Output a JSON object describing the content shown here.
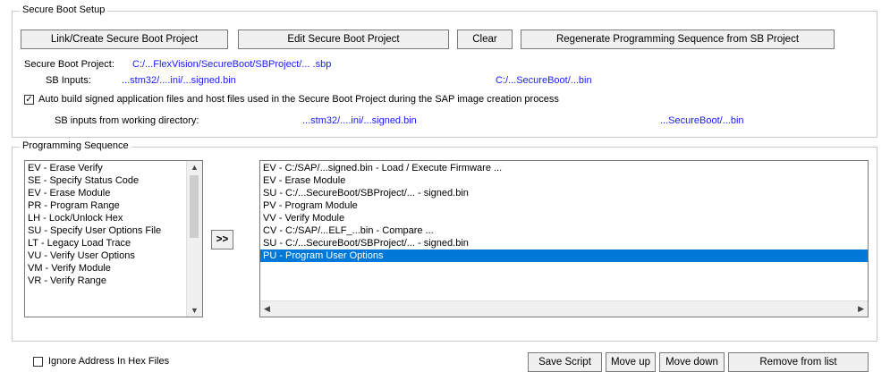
{
  "secure_boot": {
    "legend": "Secure Boot Setup",
    "buttons": {
      "link_create": "Link/Create Secure Boot Project",
      "edit": "Edit Secure Boot Project",
      "clear": "Clear",
      "regenerate": "Regenerate Programming Sequence from SB Project"
    },
    "project_label": "Secure Boot Project:",
    "project_path": "C:/...FlexVision/SecureBoot/SBProject/... .sbp",
    "sb_inputs_label": "SB Inputs:",
    "sb_inputs_path": "...stm32/....ini/...signed.bin",
    "sb_inputs_path2": "C:/...SecureBoot/...bin",
    "auto_build_checked": true,
    "auto_build_label": "Auto build signed application files and host files used in the Secure Boot Project during the SAP image creation process",
    "sb_inputs_secondary_label": "SB inputs from working directory:",
    "sb_inputs_secondary_path": "...stm32/....ini/...signed.bin",
    "sb_inputs_secondary_path2": "...SecureBoot/...bin"
  },
  "programming_sequence": {
    "legend": "Programming Sequence",
    "available_items": [
      "EV - Erase Verify",
      "SE - Specify Status Code",
      "EV - Erase Module",
      "PR - Program Range",
      "LH - Lock/Unlock Hex",
      "SU - Specify User Options File",
      "LT - Legacy Load Trace",
      "VU - Verify User Options",
      "VM - Verify Module",
      "VR - Verify Range"
    ],
    "add_button": ">>",
    "sequence_items": [
      "EV - C:/SAP/...signed.bin - Load / Execute Firmware ...",
      "EV - Erase Module",
      "SU - C:/...SecureBoot/SBProject/... - signed.bin",
      "PV - Program Module",
      "VV - Verify Module",
      "CV - C:/SAP/...ELF_...bin - Compare ...",
      "SU - C:/...SecureBoot/SBProject/... - signed.bin",
      "PU - Program User Options"
    ],
    "selected_index": 7
  },
  "bottom": {
    "ignore_checked": false,
    "ignore_label": "Ignore Address In Hex Files",
    "save_script": "Save Script",
    "move_up": "Move up",
    "move_down": "Move down",
    "remove_from_list": "Remove from list"
  },
  "colors": {
    "selection": "#0078d7",
    "link": "#1a1aff"
  }
}
